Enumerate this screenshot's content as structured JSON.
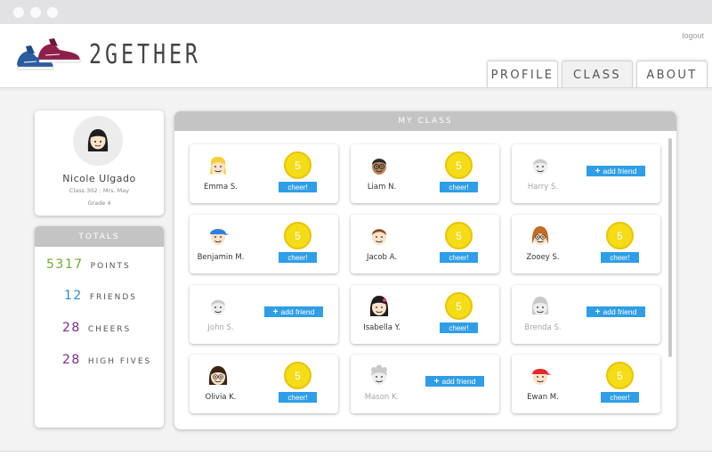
{
  "app": {
    "brand": "2GETHER",
    "logout": "logout"
  },
  "tabs": [
    {
      "label": "PROFILE",
      "active": false
    },
    {
      "label": "CLASS",
      "active": true
    },
    {
      "label": "ABOUT",
      "active": false
    }
  ],
  "profile": {
    "name": "Nicole Ulgado",
    "class_line": "Class 302 : Mrs. May",
    "grade": "Grade 4"
  },
  "totals": {
    "title": "TOTALS",
    "rows": [
      {
        "value": "5317",
        "label": "POINTS",
        "color": "#6bab2f"
      },
      {
        "value": "12",
        "label": "FRIENDS",
        "color": "#2a8fc7"
      },
      {
        "value": "28",
        "label": "CHEERS",
        "color": "#7b2d8e"
      },
      {
        "value": "28",
        "label": "HIGH FIVES",
        "color": "#7b2d8e"
      }
    ]
  },
  "class": {
    "title": "MY CLASS",
    "cheer_label": "cheer!",
    "add_label": "add friend",
    "students": [
      {
        "name": "Emma S.",
        "friend": true,
        "points": "5",
        "avatar": "emma"
      },
      {
        "name": "Liam N.",
        "friend": true,
        "points": "5",
        "avatar": "liam"
      },
      {
        "name": "Harry S.",
        "friend": false,
        "avatar": "harry"
      },
      {
        "name": "Benjamin M.",
        "friend": true,
        "points": "5",
        "avatar": "benjamin"
      },
      {
        "name": "Jacob A.",
        "friend": true,
        "points": "5",
        "avatar": "jacob"
      },
      {
        "name": "Zooey S.",
        "friend": true,
        "points": "5",
        "avatar": "zooey"
      },
      {
        "name": "John S.",
        "friend": false,
        "avatar": "john"
      },
      {
        "name": "Isabella Y.",
        "friend": true,
        "points": "5",
        "avatar": "isabella"
      },
      {
        "name": "Brenda S.",
        "friend": false,
        "avatar": "brenda"
      },
      {
        "name": "Olivia K.",
        "friend": true,
        "points": "5",
        "avatar": "olivia"
      },
      {
        "name": "Mason K.",
        "friend": false,
        "avatar": "mason"
      },
      {
        "name": "Ewan M.",
        "friend": true,
        "points": "5",
        "avatar": "ewan"
      }
    ]
  },
  "colors": {
    "accent": "#2f9ee6",
    "coin": "#f4dc16",
    "header_gray": "#c4c4c4"
  }
}
